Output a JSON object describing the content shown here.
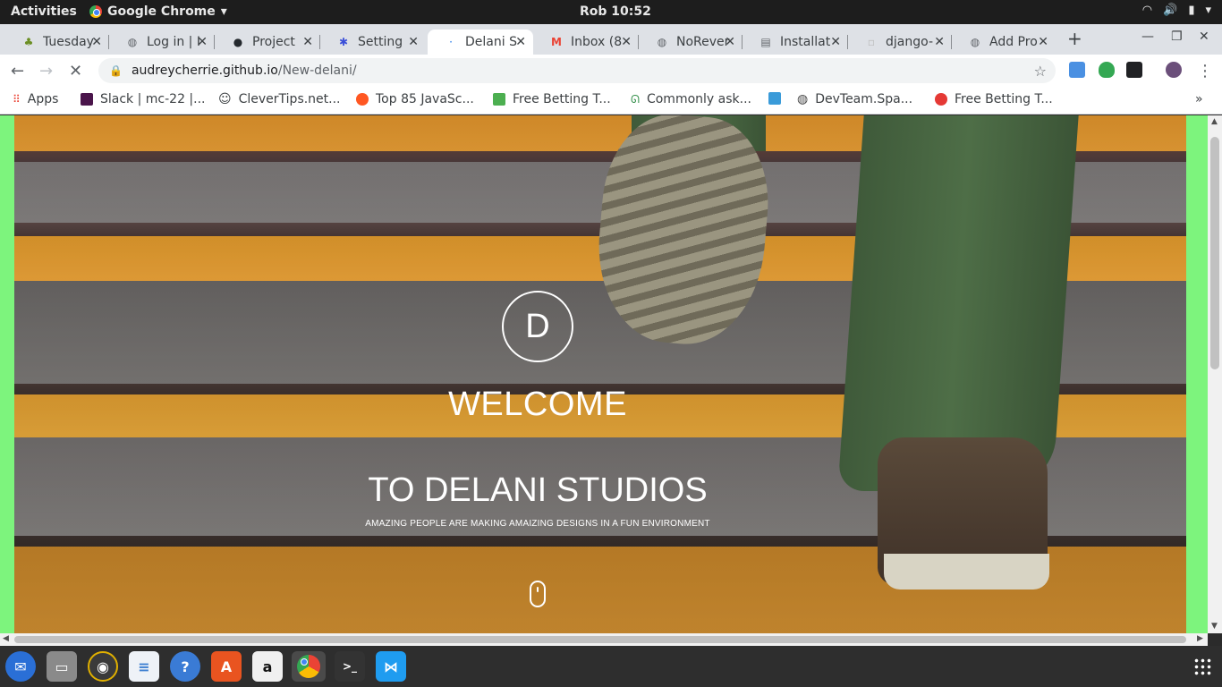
{
  "topbar": {
    "activities": "Activities",
    "app_name": "Google Chrome",
    "clock": "Rob 10:52"
  },
  "tabs": [
    {
      "title": "Tuesday",
      "icon": "tree-icon"
    },
    {
      "title": "Log in | I",
      "icon": "globe-icon"
    },
    {
      "title": "Project",
      "icon": "github-icon"
    },
    {
      "title": "Setting",
      "icon": "gear-icon"
    },
    {
      "title": "Delani S",
      "icon": "loading-icon",
      "active": true
    },
    {
      "title": "Inbox (8",
      "icon": "gmail-icon"
    },
    {
      "title": "NoRever",
      "icon": "globe-icon"
    },
    {
      "title": "Installat",
      "icon": "document-icon"
    },
    {
      "title": "django-",
      "icon": "page-icon"
    },
    {
      "title": "Add Pro",
      "icon": "globe-icon"
    }
  ],
  "address": {
    "domain": "audreycherrie.github.io",
    "path": "/New-delani/"
  },
  "bookmarks": [
    {
      "label": "Apps",
      "color": "#ea4335"
    },
    {
      "label": "Slack | mc-22 |...",
      "color": "#4a154b"
    },
    {
      "label": "CleverTips.net...",
      "color": "#555555"
    },
    {
      "label": "Top 85 JavaSc...",
      "color": "#ff5722"
    },
    {
      "label": "Free Betting T...",
      "color": "#4caf50"
    },
    {
      "label": "Commonly ask...",
      "color": "#2f8d46"
    },
    {
      "label": "DevTeam.Spa...",
      "color": "#444444"
    },
    {
      "label": "Free Betting T...",
      "color": "#e53935"
    }
  ],
  "hero": {
    "logo_letter": "D",
    "welcome": "WELCOME",
    "brand": "TO DELANI STUDIOS",
    "tagline": "AMAZING PEOPLE ARE MAKING AMAIZING DESIGNS IN A FUN ENVIRONMENT"
  },
  "dock": [
    {
      "name": "thunderbird-icon",
      "color": "#2a6fd6"
    },
    {
      "name": "files-icon",
      "color": "#8a8a8a"
    },
    {
      "name": "rhythmbox-icon",
      "color": "#e0b000"
    },
    {
      "name": "writer-icon",
      "color": "#3d7fd1"
    },
    {
      "name": "help-icon",
      "color": "#3a7bd5"
    },
    {
      "name": "software-icon",
      "color": "#e95420"
    },
    {
      "name": "amazon-icon",
      "color": "#f0f0f0"
    },
    {
      "name": "chrome-icon",
      "color": "#4285f4"
    },
    {
      "name": "terminal-icon",
      "color": "#333333"
    },
    {
      "name": "vscode-icon",
      "color": "#1f9cf0"
    }
  ],
  "colors": {
    "page_background": "#7df47d",
    "accent": "#ffffff"
  }
}
